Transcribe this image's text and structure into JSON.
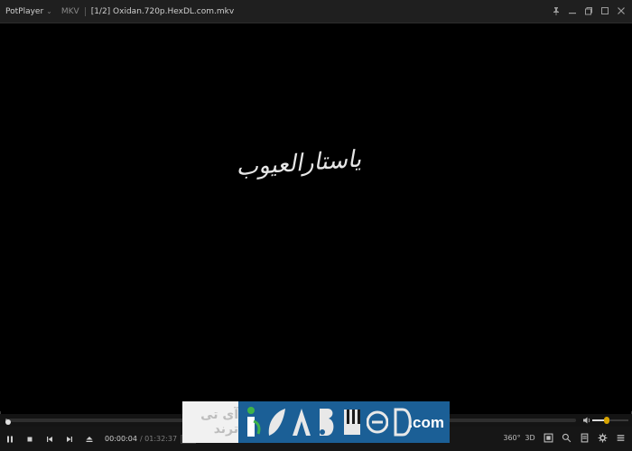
{
  "titlebar": {
    "app_name": "PotPlayer",
    "format": "MKV",
    "file_title": "[1/2] Oxidan.720p.HexDL.com.mkv"
  },
  "video": {
    "calligraphy_text": "یاستارالعیوب"
  },
  "seek": {
    "progress_fraction": 0.0007
  },
  "volume": {
    "level_fraction": 0.4
  },
  "controls": {
    "elapsed": "00:00:04",
    "duration": "/ 01:32:37",
    "decoder_badge": "SW",
    "view_360_label": "360°",
    "view_3d_label": "3D"
  },
  "banner": {
    "persian_text": "آی تی ترند",
    "com_text": ".com"
  },
  "colors": {
    "accent": "#d6a300",
    "banner_blue": "#1b5f96",
    "banner_red": "#e0262a",
    "banner_green": "#2a9c3f"
  }
}
